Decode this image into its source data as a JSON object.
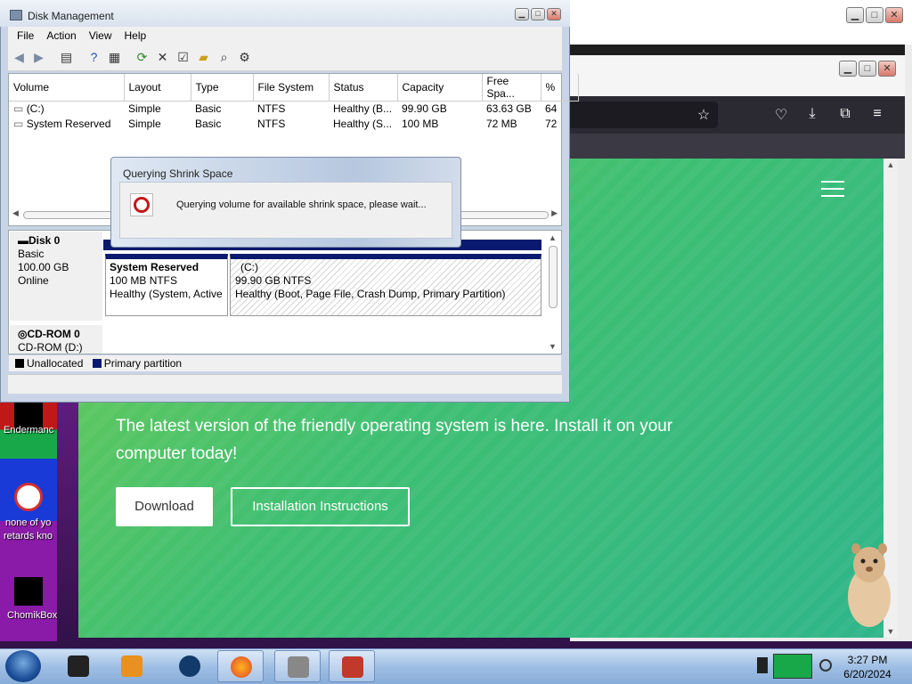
{
  "disk_management": {
    "title": "Disk Management",
    "menu": [
      "File",
      "Action",
      "View",
      "Help"
    ],
    "columns": [
      "Volume",
      "Layout",
      "Type",
      "File System",
      "Status",
      "Capacity",
      "Free Spa...",
      "%"
    ],
    "rows": [
      [
        "(C:)",
        "Simple",
        "Basic",
        "NTFS",
        "Healthy (B...",
        "99.90 GB",
        "63.63 GB",
        "64"
      ],
      [
        "System Reserved",
        "Simple",
        "Basic",
        "NTFS",
        "Healthy (S...",
        "100 MB",
        "72 MB",
        "72"
      ]
    ],
    "disk0": {
      "name": "Disk 0",
      "type": "Basic",
      "size": "100.00 GB",
      "state": "Online"
    },
    "partitions": [
      {
        "name": "System Reserved",
        "fs": "100 MB NTFS",
        "status": "Healthy (System, Active"
      },
      {
        "name": "(C:)",
        "fs": "99.90 GB NTFS",
        "status": "Healthy (Boot, Page File, Crash Dump, Primary Partition)"
      }
    ],
    "cdrom": {
      "name": "CD-ROM 0",
      "drive": "CD-ROM (D:)"
    },
    "legend": {
      "unallocated": "Unallocated",
      "primary": "Primary partition"
    }
  },
  "dialog": {
    "title": "Querying Shrink Space",
    "message": "Querying volume for available shrink space, please wait..."
  },
  "page": {
    "hero": "The latest version of the friendly operating system is here. Install it on your computer today!",
    "download": "Download",
    "install": "Installation Instructions"
  },
  "desktop": {
    "icon1": "Endermanc",
    "icon2_line1": "none of yo",
    "icon2_line2": "retards kno",
    "icon3": "ChomikBox"
  },
  "taskbar": {
    "time": "3:27 PM",
    "date": "6/20/2024"
  },
  "colors": {
    "accent_green": "#3fbf72",
    "partition_primary": "#0a1a6e",
    "taskbar": "#9fbfe4"
  }
}
